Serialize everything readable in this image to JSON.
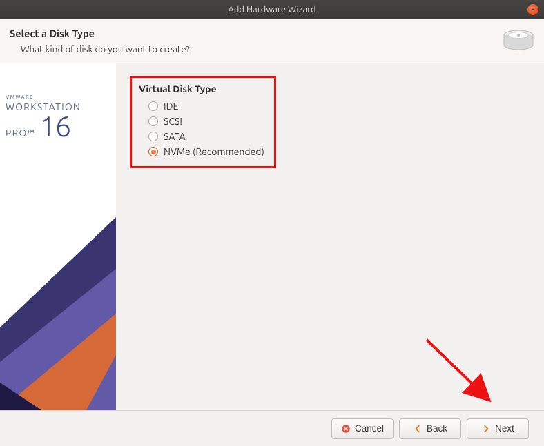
{
  "window": {
    "title": "Add Hardware Wizard"
  },
  "header": {
    "title": "Select a Disk Type",
    "subtitle": "What kind of disk do you want to create?"
  },
  "brand": {
    "vendor": "VMWARE",
    "product": "WORKSTATION",
    "edition": "PRO",
    "version": "16"
  },
  "disk_type": {
    "group_label": "Virtual Disk Type",
    "options": {
      "ide": "IDE",
      "scsi": "SCSI",
      "sata": "SATA",
      "nvme": "NVMe (Recommended)"
    },
    "selected": "nvme"
  },
  "buttons": {
    "cancel": "Cancel",
    "back": "Back",
    "next": "Next"
  }
}
